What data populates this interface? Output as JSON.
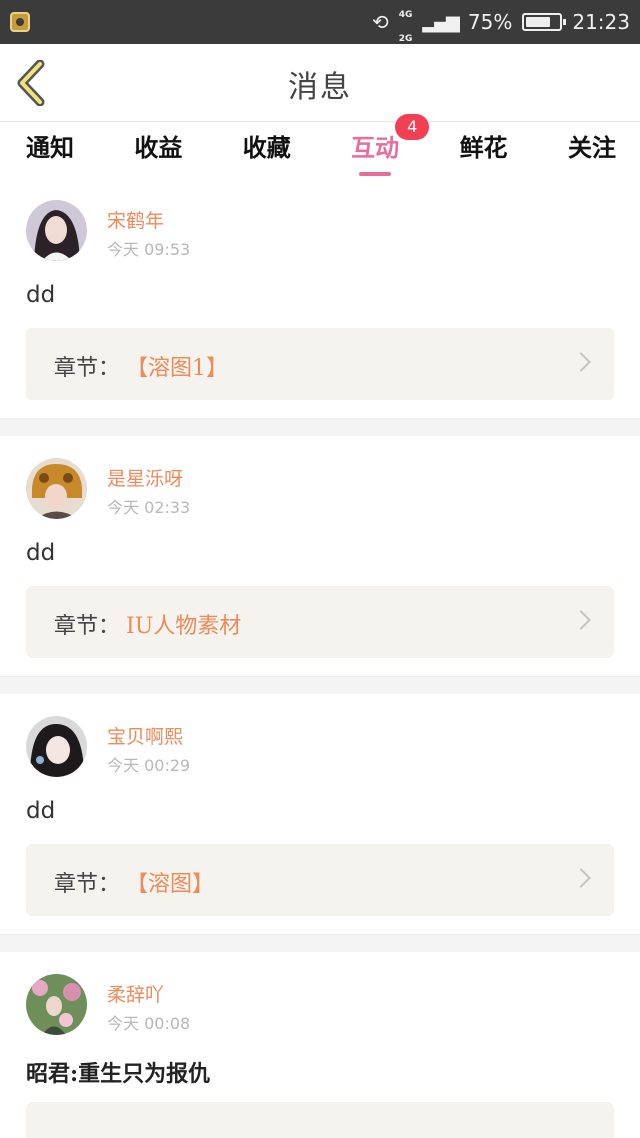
{
  "status_bar": {
    "network_top": "4G",
    "network_bottom": "2G",
    "battery": "75%",
    "battery_level": 0.75,
    "time": "21:23"
  },
  "header": {
    "title": "消息"
  },
  "tabs": [
    {
      "label": "通知",
      "active": false
    },
    {
      "label": "收益",
      "active": false
    },
    {
      "label": "收藏",
      "active": false
    },
    {
      "label": "互动",
      "active": true,
      "badge": "4"
    },
    {
      "label": "鲜花",
      "active": false
    },
    {
      "label": "关注",
      "active": false
    }
  ],
  "colors": {
    "accent": "#e86d9b",
    "username": "#ef8a5a",
    "badge": "#f23f52",
    "chapter_bg": "#f4f3ee"
  },
  "messages": [
    {
      "username": "宋鹤年",
      "time": "今天  09:53",
      "text": "dd",
      "chapter_label": "章节：",
      "chapter_value": "【溶图1】"
    },
    {
      "username": "是星泺呀",
      "time": "今天  02:33",
      "text": "dd",
      "chapter_label": "章节：",
      "chapter_value": "IU人物素材"
    },
    {
      "username": "宝贝啊熙",
      "time": "今天  00:29",
      "text": "dd",
      "chapter_label": "章节：",
      "chapter_value": "【溶图】"
    },
    {
      "username": "柔辞吖",
      "time": "今天  00:08",
      "text": "昭君:重生只为报仇"
    }
  ]
}
